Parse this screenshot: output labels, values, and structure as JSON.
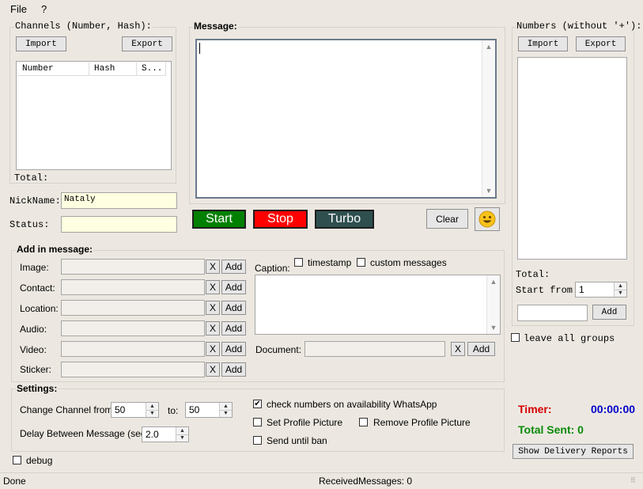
{
  "menu": {
    "file": "File",
    "help": "?"
  },
  "channels": {
    "title": "Channels (Number, Hash):",
    "import": "Import",
    "export": "Export",
    "columns": [
      "Number",
      "Hash",
      "S..."
    ],
    "total": "Total:"
  },
  "nickname": {
    "label": "NickName:",
    "value": "Nataly"
  },
  "status": {
    "label": "Status:",
    "value": ""
  },
  "message": {
    "title": "Message:",
    "start": "Start",
    "stop": "Stop",
    "turbo": "Turbo",
    "clear": "Clear"
  },
  "numbers": {
    "title": "Numbers (without '+'):",
    "import": "Import",
    "export": "Export",
    "total": "Total:",
    "start_from_label": "Start from:",
    "start_from_value": "1",
    "add": "Add",
    "leave_groups": "leave all groups"
  },
  "add_in_message": {
    "title": "Add in message:",
    "rows": [
      {
        "label": "Image:",
        "x": "X",
        "add": "Add"
      },
      {
        "label": "Contact:",
        "x": "X",
        "add": "Add"
      },
      {
        "label": "Location:",
        "x": "X",
        "add": "Add"
      },
      {
        "label": "Audio:",
        "x": "X",
        "add": "Add"
      },
      {
        "label": "Video:",
        "x": "X",
        "add": "Add"
      },
      {
        "label": "Sticker:",
        "x": "X",
        "add": "Add"
      }
    ],
    "caption": "Caption:",
    "timestamp": "timestamp",
    "custom_messages": "custom messages",
    "document": "Document:",
    "doc_x": "X",
    "doc_add": "Add"
  },
  "settings": {
    "title": "Settings:",
    "change_channel_from": "Change Channel from:",
    "from_value": "50",
    "to_label": "to:",
    "to_value": "50",
    "delay_label": "Delay Between Message (sec)",
    "delay_value": "2.0",
    "check_numbers": "check numbers on availability WhatsApp",
    "set_profile": "Set Profile Picture",
    "remove_profile": "Remove Profile Picture",
    "send_until_ban": "Send until ban"
  },
  "stats": {
    "timer_label": "Timer:",
    "timer_value": "00:00:00",
    "total_sent": "Total Sent: 0",
    "show_reports": "Show Delivery Reports"
  },
  "debug": "debug",
  "statusbar": {
    "left": "Done",
    "center": "ReceivedMessages: 0"
  },
  "colors": {
    "start": "#008000",
    "stop": "#ff0000",
    "turbo": "#2f4f4f",
    "timer_label": "#d40000",
    "timer_value": "#0000cc",
    "total_sent": "#0a8a0a"
  }
}
